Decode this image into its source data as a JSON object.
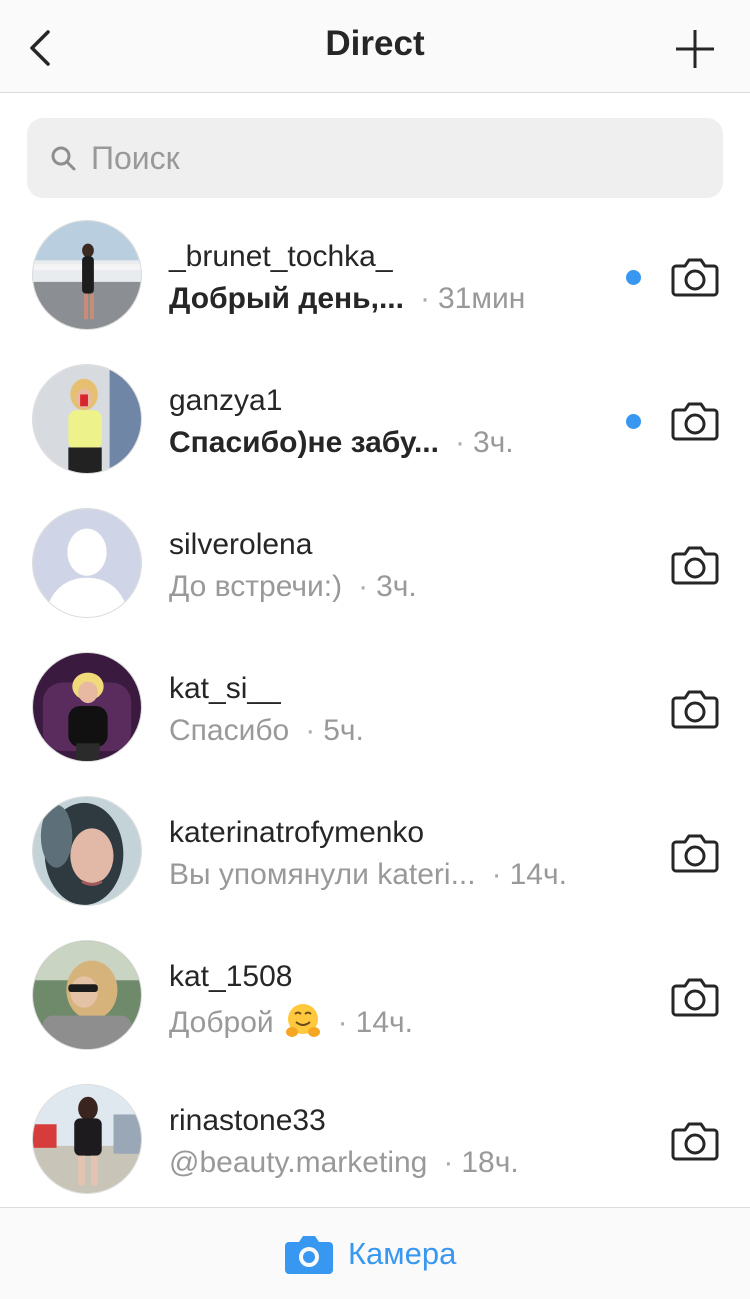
{
  "header": {
    "title": "Direct",
    "back_icon": "chevron-left-icon",
    "new_icon": "plus-icon"
  },
  "search": {
    "placeholder": "Поиск",
    "value": ""
  },
  "threads": [
    {
      "username": "_brunet_tochka_",
      "message": "Добрый день,...",
      "time": "31мин",
      "unread": true
    },
    {
      "username": "ganzya1",
      "message": "Спасибо)не забу...",
      "time": "3ч.",
      "unread": true
    },
    {
      "username": "silverolena",
      "message": "До встречи:)",
      "time": "3ч.",
      "unread": false
    },
    {
      "username": "kat_si__",
      "message": "Спасибо",
      "time": "5ч.",
      "unread": false
    },
    {
      "username": "katerinatrofymenko",
      "message": "Вы упомянули kateri...",
      "time": "14ч.",
      "unread": false
    },
    {
      "username": "kat_1508",
      "message": "Доброй",
      "time": "14ч.",
      "unread": false,
      "emoji": "hugging-face"
    },
    {
      "username": "rinastone33",
      "message": "@beauty.marketing",
      "time": "18ч.",
      "unread": false
    }
  ],
  "separator": "·",
  "footer": {
    "camera_label": "Камера"
  },
  "colors": {
    "accent": "#3897f0",
    "text": "#262626",
    "muted": "#999999"
  }
}
